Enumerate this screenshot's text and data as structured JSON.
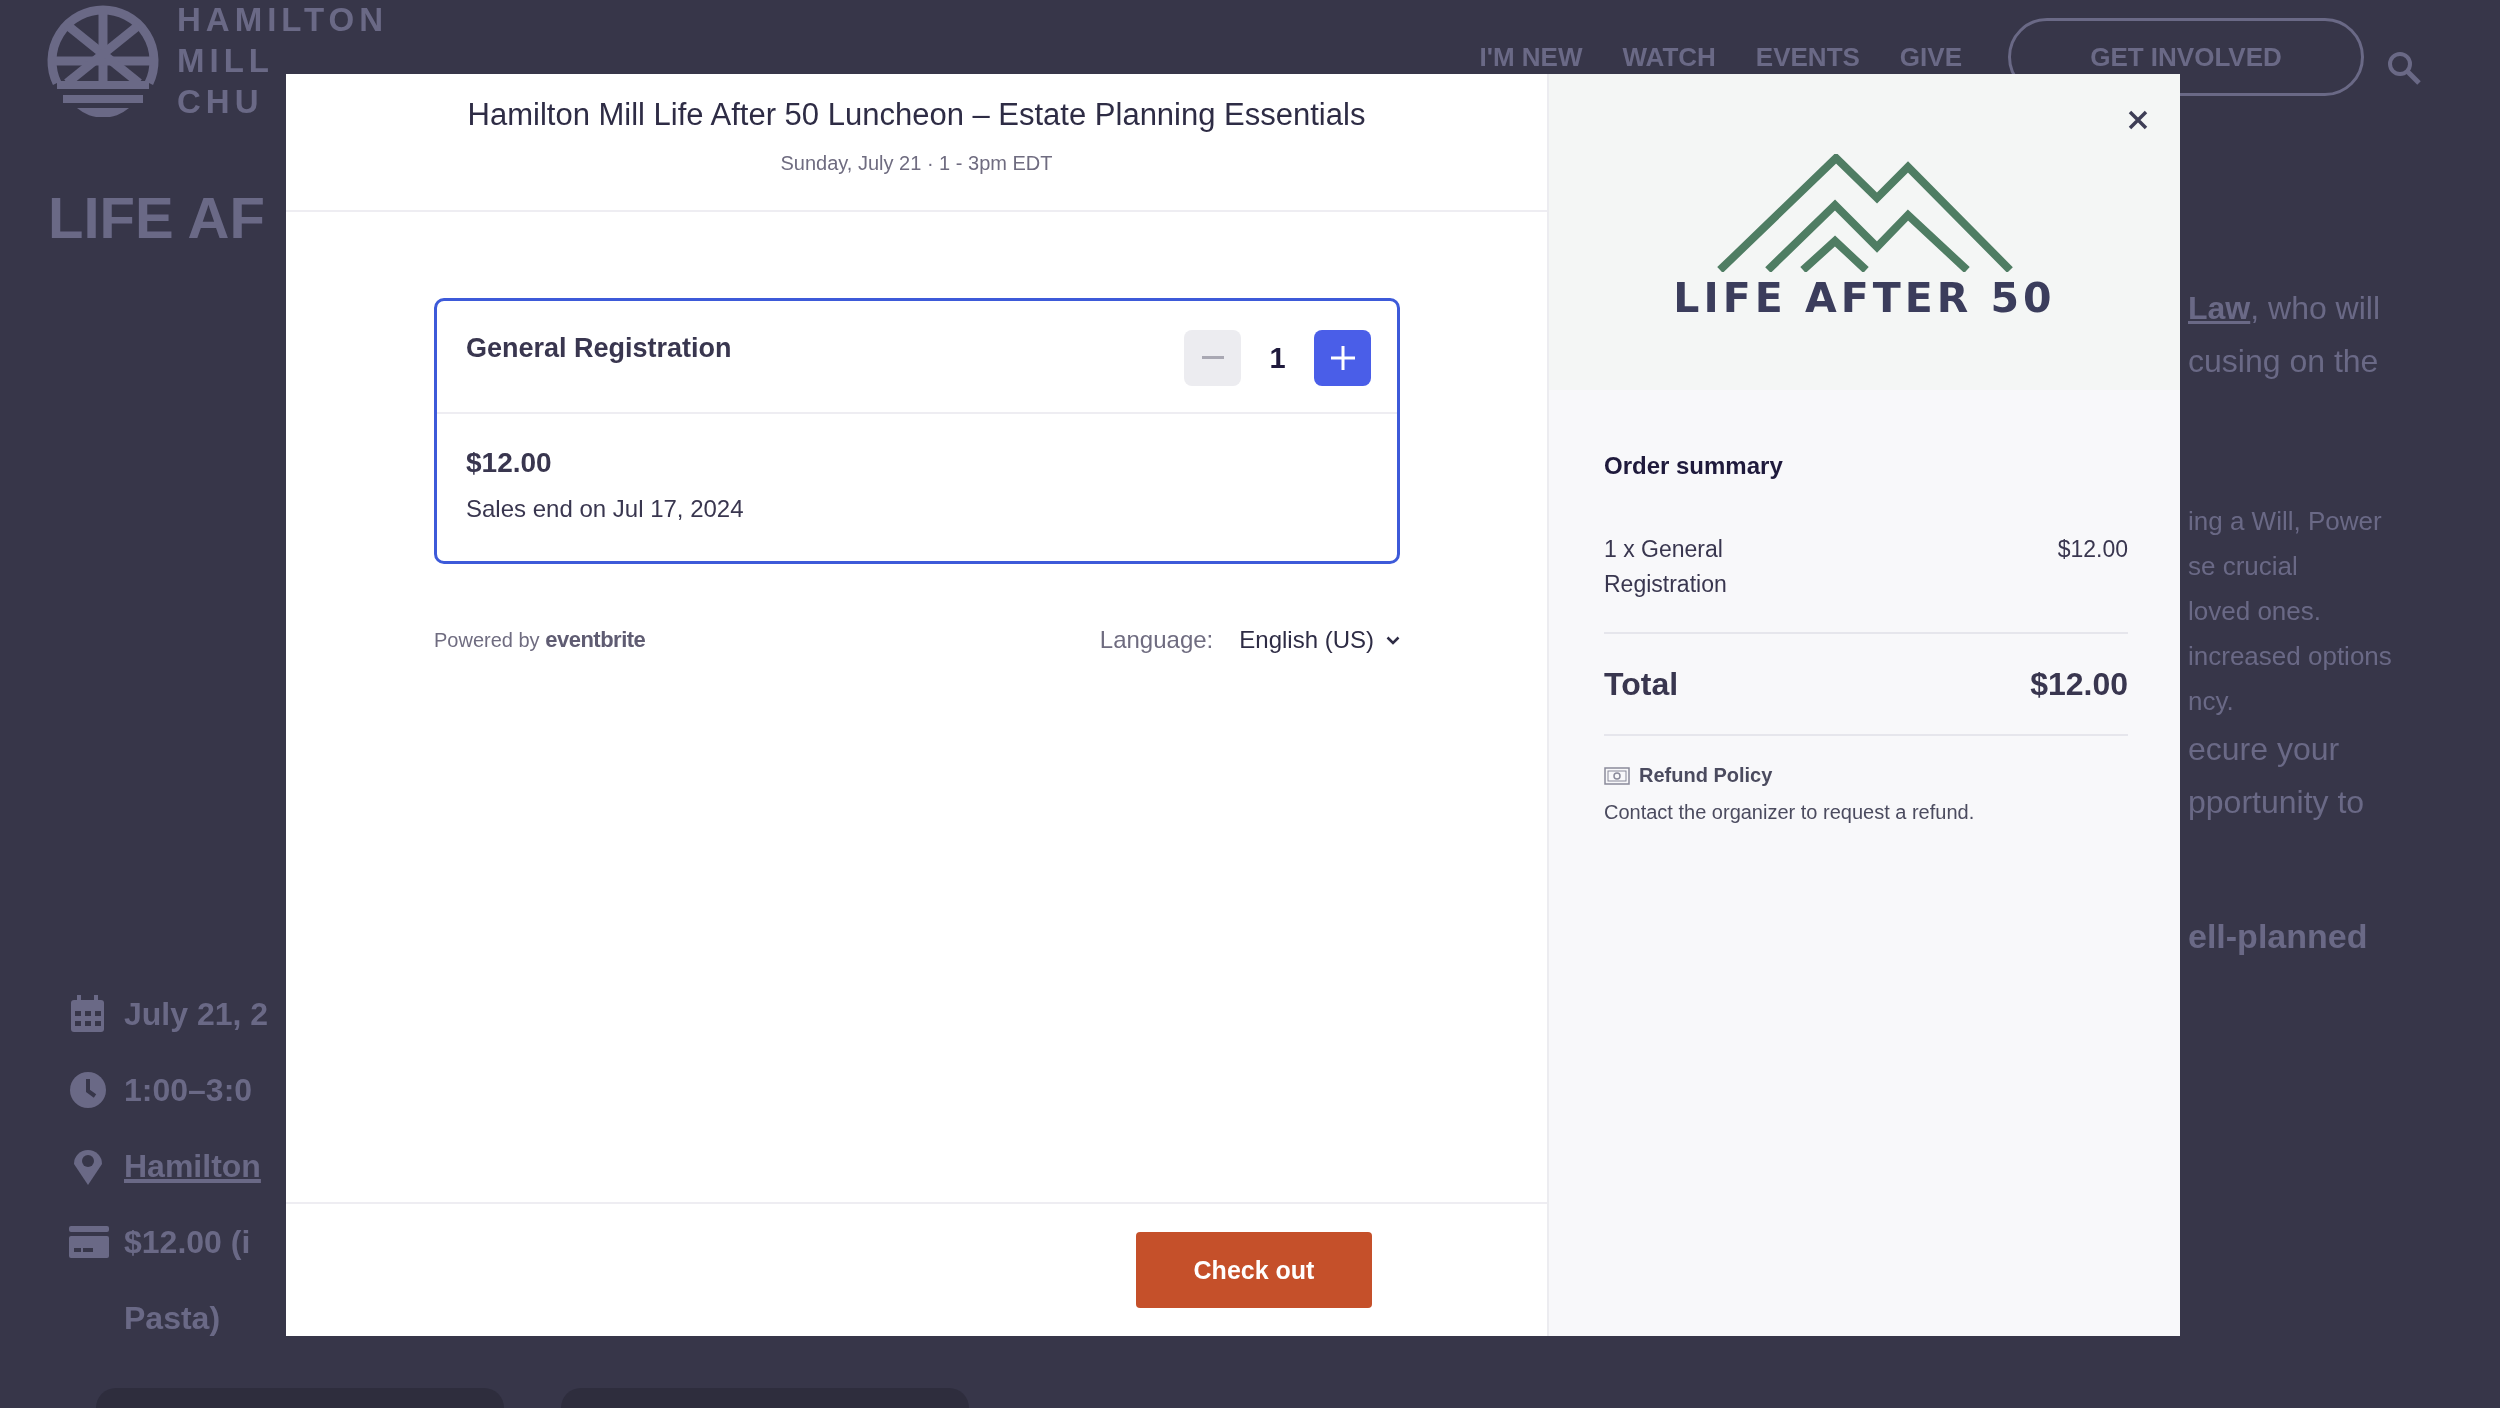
{
  "background_page": {
    "logo_lines": [
      "HAMILTON",
      "MILL",
      "CHU"
    ],
    "nav": [
      {
        "label": "I'M NEW"
      },
      {
        "label": "WATCH"
      },
      {
        "label": "EVENTS"
      },
      {
        "label": "GIVE"
      }
    ],
    "cta": "GET INVOLVED",
    "title": "LIFE AF",
    "details": [
      {
        "kind": "date",
        "text": "July 21, 2"
      },
      {
        "kind": "time",
        "text": "1:00–3:0"
      },
      {
        "kind": "location",
        "text": "Hamilton"
      },
      {
        "kind": "price",
        "text": "$12.00 (i"
      },
      {
        "kind": "continuation",
        "text": "Pasta)"
      }
    ],
    "fragments": [
      {
        "kind": "link",
        "link": "Law",
        "text": ", who will"
      },
      {
        "kind": "large",
        "text": "cusing on the"
      },
      {
        "kind": "gap"
      },
      {
        "kind": "small",
        "text": "ing a Will, Power"
      },
      {
        "kind": "small",
        "text": "se crucial"
      },
      {
        "kind": "small",
        "text": "loved ones."
      },
      {
        "kind": "small",
        "text": "increased options"
      },
      {
        "kind": "small",
        "text": "ncy."
      },
      {
        "kind": "large",
        "text": "ecure your"
      },
      {
        "kind": "large",
        "text": "pportunity to"
      },
      {
        "kind": "bold",
        "text": "ell-planned"
      }
    ]
  },
  "modal": {
    "title": "Hamilton Mill Life After 50 Luncheon – Estate Planning Essentials",
    "subtitle": "Sunday, July 21 · 1 - 3pm EDT",
    "ticket": {
      "name": "General Registration",
      "quantity": "1",
      "decrease_disabled": true,
      "price": "$12.00",
      "sales_end": "Sales end on Jul 17, 2024"
    },
    "powered_by": {
      "prefix": "Powered by",
      "brand": "eventbrite"
    },
    "language": {
      "label": "Language:",
      "value": "English (US)"
    },
    "checkout": "Check out"
  },
  "summary": {
    "logo_text": "LIFE AFTER 50",
    "heading": "Order summary",
    "items": [
      {
        "label": "1 x General Registration",
        "amount": "$12.00"
      }
    ],
    "total_label": "Total",
    "total": "$12.00",
    "refund_title": "Refund Policy",
    "refund_text": "Contact the organizer to request a refund."
  }
}
